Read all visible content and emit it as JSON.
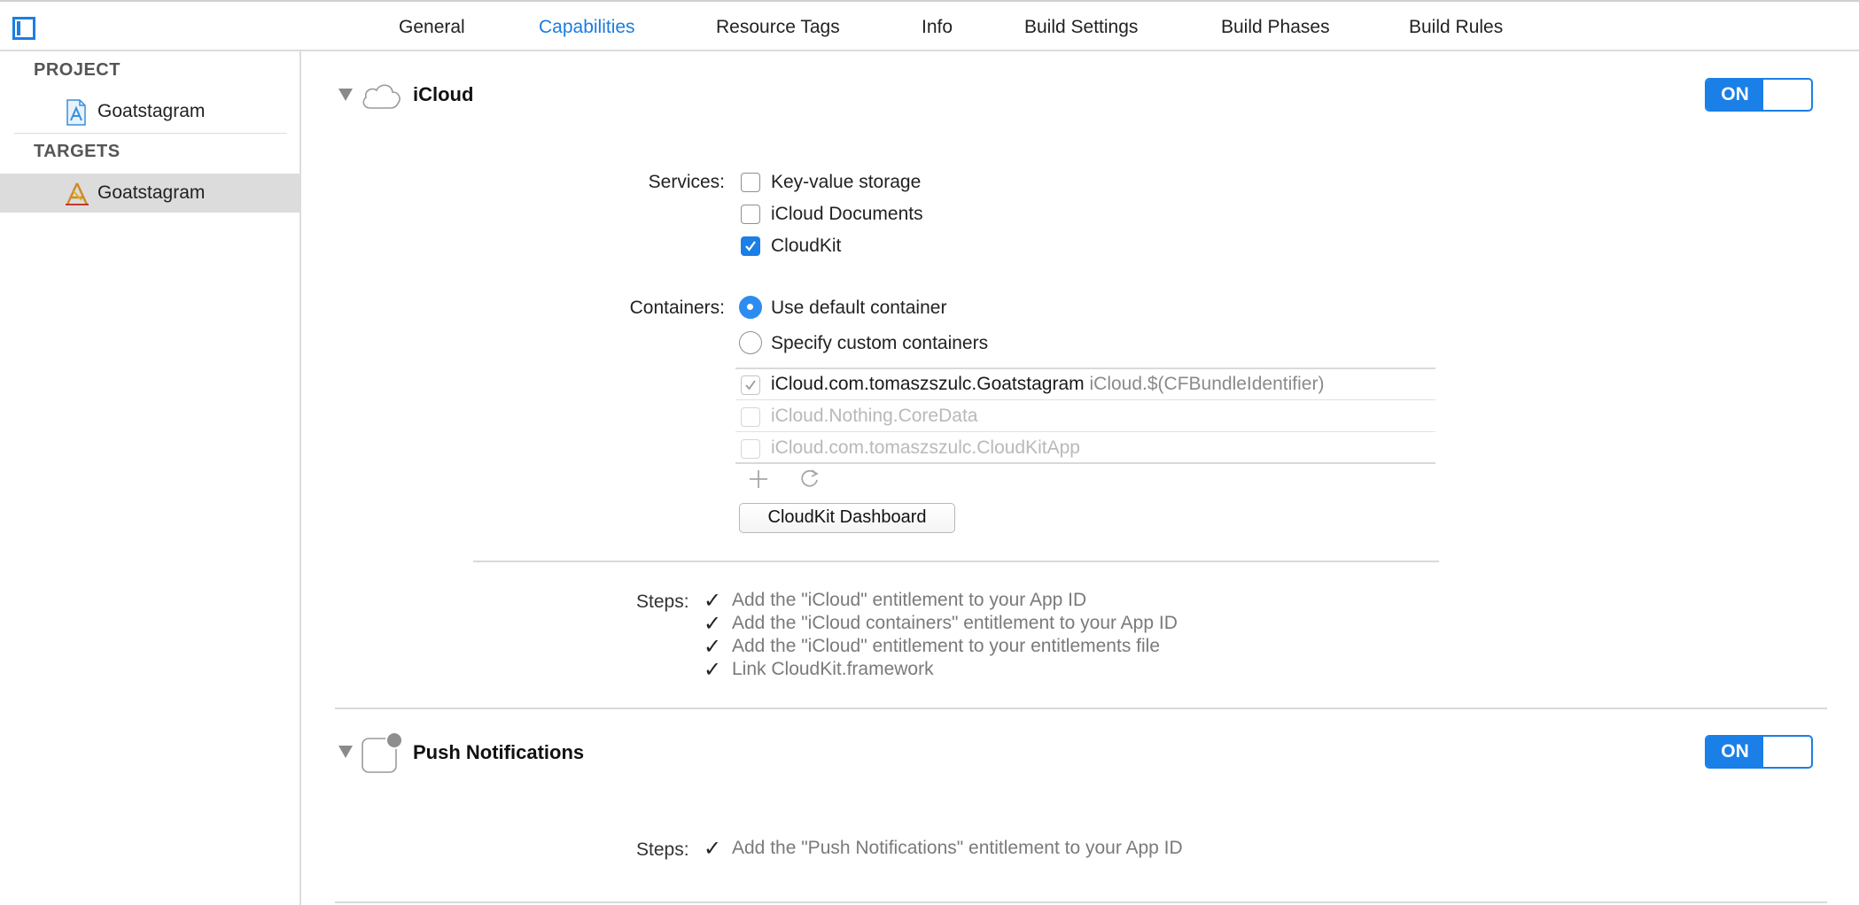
{
  "tabs": [
    {
      "label": "General"
    },
    {
      "label": "Capabilities",
      "active": true
    },
    {
      "label": "Resource Tags"
    },
    {
      "label": "Info"
    },
    {
      "label": "Build Settings"
    },
    {
      "label": "Build Phases"
    },
    {
      "label": "Build Rules"
    }
  ],
  "sidebar": {
    "project_header": "PROJECT",
    "project_item": "Goatstagram",
    "targets_header": "TARGETS",
    "target_item": "Goatstagram"
  },
  "icloud": {
    "title": "iCloud",
    "toggle": "ON",
    "services_label": "Services:",
    "services": [
      {
        "label": "Key-value storage",
        "checked": false
      },
      {
        "label": "iCloud Documents",
        "checked": false
      },
      {
        "label": "CloudKit",
        "checked": true
      }
    ],
    "containers_label": "Containers:",
    "container_options": [
      {
        "label": "Use default container",
        "selected": true
      },
      {
        "label": "Specify custom containers",
        "selected": false
      }
    ],
    "containers": [
      {
        "name": "iCloud.com.tomaszszulc.Goatstagram",
        "detail": "iCloud.$(CFBundleIdentifier)",
        "checked": true,
        "enabled": false
      },
      {
        "name": "iCloud.Nothing.CoreData",
        "detail": "",
        "checked": false,
        "enabled": false
      },
      {
        "name": "iCloud.com.tomaszszulc.CloudKitApp",
        "detail": "",
        "checked": false,
        "enabled": false
      }
    ],
    "dashboard_button": "CloudKit Dashboard",
    "steps_label": "Steps:",
    "steps": [
      "Add the \"iCloud\" entitlement to your App ID",
      "Add the \"iCloud containers\" entitlement to your App ID",
      "Add the \"iCloud\" entitlement to your entitlements file",
      "Link CloudKit.framework"
    ]
  },
  "push": {
    "title": "Push Notifications",
    "toggle": "ON",
    "steps_label": "Steps:",
    "steps": [
      "Add the \"Push Notifications\" entitlement to your App ID"
    ]
  },
  "icons": {
    "navigator_toggle": "sidebar-toggle-icon",
    "project": "project-file-icon",
    "target": "app-target-icon",
    "icloud": "cloud-icon",
    "push": "push-notification-icon",
    "add": "plus-icon",
    "refresh": "refresh-icon",
    "step_check": "checkmark-icon"
  },
  "colors": {
    "accent": "#1a7fe6",
    "selection": "#dcdcdc"
  }
}
